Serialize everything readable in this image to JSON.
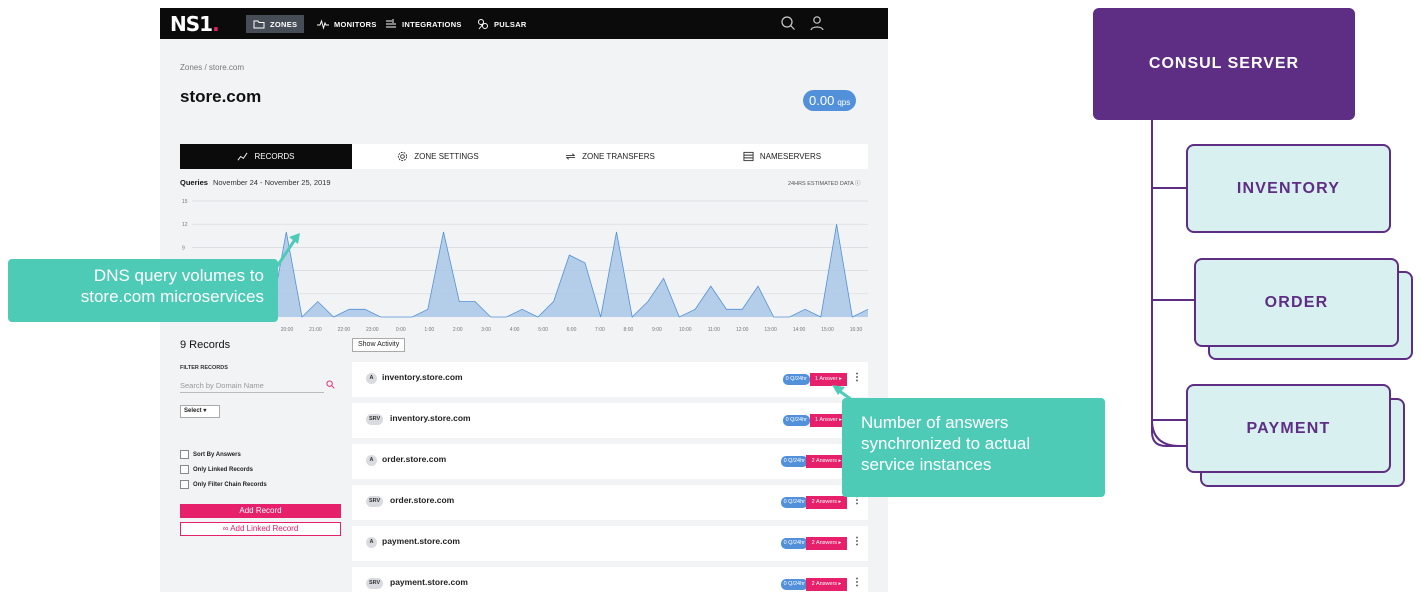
{
  "nav": {
    "logo": "NS1",
    "logo_dot": ".",
    "items": [
      {
        "label": "ZONES",
        "icon": "folder-icon",
        "active": true
      },
      {
        "label": "MONITORS",
        "icon": "pulse-icon",
        "active": false
      },
      {
        "label": "INTEGRATIONS",
        "icon": "plug-icon",
        "active": false
      },
      {
        "label": "PULSAR",
        "icon": "pulsar-icon",
        "active": false
      }
    ],
    "right_icons": [
      "search-icon",
      "user-icon"
    ]
  },
  "breadcrumb": "Zones / store.com",
  "zone": {
    "title": "store.com",
    "qps_value": "0.00",
    "qps_unit": "qps"
  },
  "tabs": [
    {
      "label": "RECORDS",
      "icon": "chart-line-icon",
      "active": true
    },
    {
      "label": "ZONE SETTINGS",
      "icon": "gear-icon",
      "active": false
    },
    {
      "label": "ZONE TRANSFERS",
      "icon": "transfer-icon",
      "active": false
    },
    {
      "label": "NAMESERVERS",
      "icon": "server-icon",
      "active": false
    }
  ],
  "queries": {
    "label": "Queries",
    "range": "November 24 - November 25, 2019",
    "estimate_label": "24HRS ESTIMATED DATA ⓘ"
  },
  "chart_data": {
    "type": "area",
    "ylim": [
      0,
      15
    ],
    "yticks": [
      15,
      12,
      9
    ],
    "xtick_labels": [
      "20:00",
      "21:00",
      "22:00",
      "23:00",
      "0:00",
      "1:00",
      "2:00",
      "3:00",
      "4:00",
      "5:00",
      "6:00",
      "7:00",
      "8:00",
      "9:00",
      "10:00",
      "11:00",
      "12:00",
      "13:00",
      "14:00",
      "15:00",
      "16:30"
    ],
    "values": [
      0,
      2,
      0,
      0,
      1,
      0,
      11,
      0,
      2,
      0,
      1,
      1,
      0,
      0,
      0,
      1,
      11,
      2,
      2,
      0,
      0,
      1,
      0,
      2,
      8,
      7,
      0,
      11,
      0,
      2,
      5,
      0,
      1,
      4,
      1,
      1,
      4,
      0,
      0,
      1,
      0,
      12,
      0,
      1
    ],
    "grid": true,
    "color": "#a9c7e8",
    "line_color": "#5291d9"
  },
  "records": {
    "count_label": "9 Records",
    "show_activity": "Show Activity",
    "filter_label": "FILTER RECORDS",
    "search_placeholder": "Search by Domain Name",
    "select_label": "Select ▾",
    "options": [
      "Sort By Answers",
      "Only Linked Records",
      "Only Filter Chain Records"
    ],
    "add_record": "Add Record",
    "add_linked_record": "∞ Add Linked Record",
    "rows": [
      {
        "type": "A",
        "name": "inventory.store.com",
        "queries": "0 Q/24hr",
        "answers": "1 Answer ▸"
      },
      {
        "type": "SRV",
        "name": "inventory.store.com",
        "queries": "0 Q/24hr",
        "answers": "1 Answer ▸"
      },
      {
        "type": "A",
        "name": "order.store.com",
        "queries": "0 Q/24hr",
        "answers": "2 Answers ▸"
      },
      {
        "type": "SRV",
        "name": "order.store.com",
        "queries": "0 Q/24hr",
        "answers": "2 Answers ▸"
      },
      {
        "type": "A",
        "name": "payment.store.com",
        "queries": "0 Q/24hr",
        "answers": "2 Answers ▸"
      },
      {
        "type": "SRV",
        "name": "payment.store.com",
        "queries": "0 Q/24hr",
        "answers": "2 Answers ▸"
      }
    ]
  },
  "callouts": {
    "dns_line1": "DNS query volumes to",
    "dns_line2": "store.com microservices",
    "answers_line1": "Number of answers",
    "answers_line2": "synchronized to actual",
    "answers_line3": "service instances",
    "color": "#4ecbb7"
  },
  "diagram": {
    "server_label": "CONSUL SERVER",
    "services": [
      "INVENTORY",
      "ORDER",
      "PAYMENT"
    ],
    "purple": "#5e2e85",
    "teal_fill": "#d9f0f0"
  }
}
